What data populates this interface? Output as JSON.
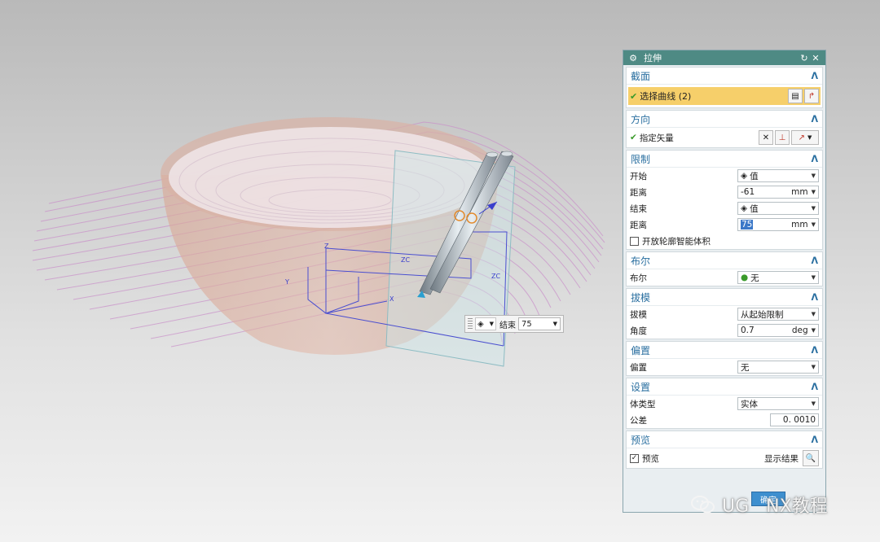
{
  "dialog": {
    "title": "拉伸",
    "sections": {
      "section": {
        "title": "截面",
        "select_curve": "选择曲线 (2)"
      },
      "direction": {
        "title": "方向",
        "vector": "指定矢量"
      },
      "limits": {
        "title": "限制",
        "start_label": "开始",
        "start_value": "值",
        "start_distance_label": "距离",
        "start_distance": "-61",
        "start_unit": "mm",
        "end_label": "结束",
        "end_value": "值",
        "end_distance_label": "距离",
        "end_distance": "75",
        "end_unit": "mm",
        "open_profile": "开放轮廓智能体积"
      },
      "boolean": {
        "title": "布尔",
        "label": "布尔",
        "value": "无"
      },
      "draft": {
        "title": "拔模",
        "draft_label": "拔模",
        "draft_value": "从起始限制",
        "angle_label": "角度",
        "angle_value": "0.7",
        "angle_unit": "deg"
      },
      "offset": {
        "title": "偏置",
        "label": "偏置",
        "value": "无"
      },
      "settings": {
        "title": "设置",
        "body_type_label": "体类型",
        "body_type_value": "实体",
        "tolerance_label": "公差",
        "tolerance_value": "0. 0010"
      },
      "preview": {
        "title": "预览",
        "checkbox_label": "预览",
        "show_result": "显示结果"
      }
    },
    "ok_button": "确定"
  },
  "mini_toolbar": {
    "label": "结束",
    "value": "75"
  },
  "watermark": "UG   NX教程",
  "colors": {
    "titlebar": "#4e8a84",
    "section_title": "#2a6fa0",
    "selected_row": "#f6cf6a"
  }
}
